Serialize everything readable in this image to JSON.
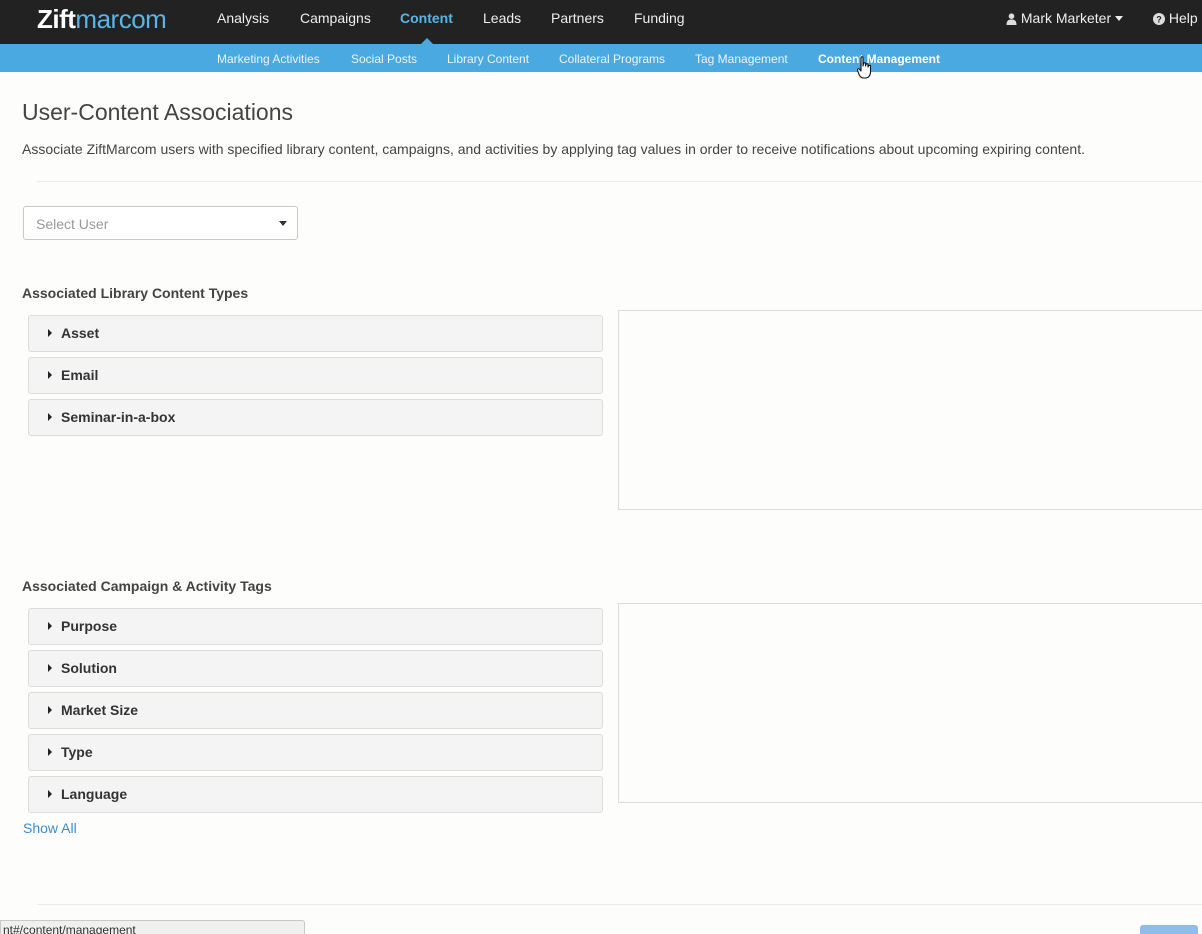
{
  "header": {
    "logo_bold": "Zift",
    "logo_thin": "marcom",
    "nav": [
      "Analysis",
      "Campaigns",
      "Content",
      "Leads",
      "Partners",
      "Funding"
    ],
    "active_nav": "Content",
    "user": "Mark Marketer",
    "help": "Help"
  },
  "subnav": {
    "items": [
      "Marketing Activities",
      "Social Posts",
      "Library Content",
      "Collateral Programs",
      "Tag Management",
      "Content Management"
    ],
    "active": "Content Management"
  },
  "page": {
    "title": "User-Content Associations",
    "description": "Associate ZiftMarcom users with specified library content, campaigns, and activities by applying tag values in order to receive notifications about upcoming expiring content."
  },
  "user_select": {
    "placeholder": "Select User"
  },
  "library_section": {
    "heading": "Associated Library Content Types",
    "items": [
      "Asset",
      "Email",
      "Seminar-in-a-box"
    ]
  },
  "tags_section": {
    "heading": "Associated Campaign & Activity Tags",
    "items": [
      "Purpose",
      "Solution",
      "Market Size",
      "Type",
      "Language"
    ],
    "show_all": "Show All"
  },
  "status_bar": {
    "url": "nt#/content/management"
  },
  "colors": {
    "topnav": "#222222",
    "subnav": "#4aa9e0",
    "accent": "#5ab4e5",
    "link": "#3a8ccc"
  },
  "icons": [
    "user-icon",
    "question-circle-icon",
    "caret-down-icon",
    "caret-right-icon",
    "hand-pointer-icon"
  ]
}
